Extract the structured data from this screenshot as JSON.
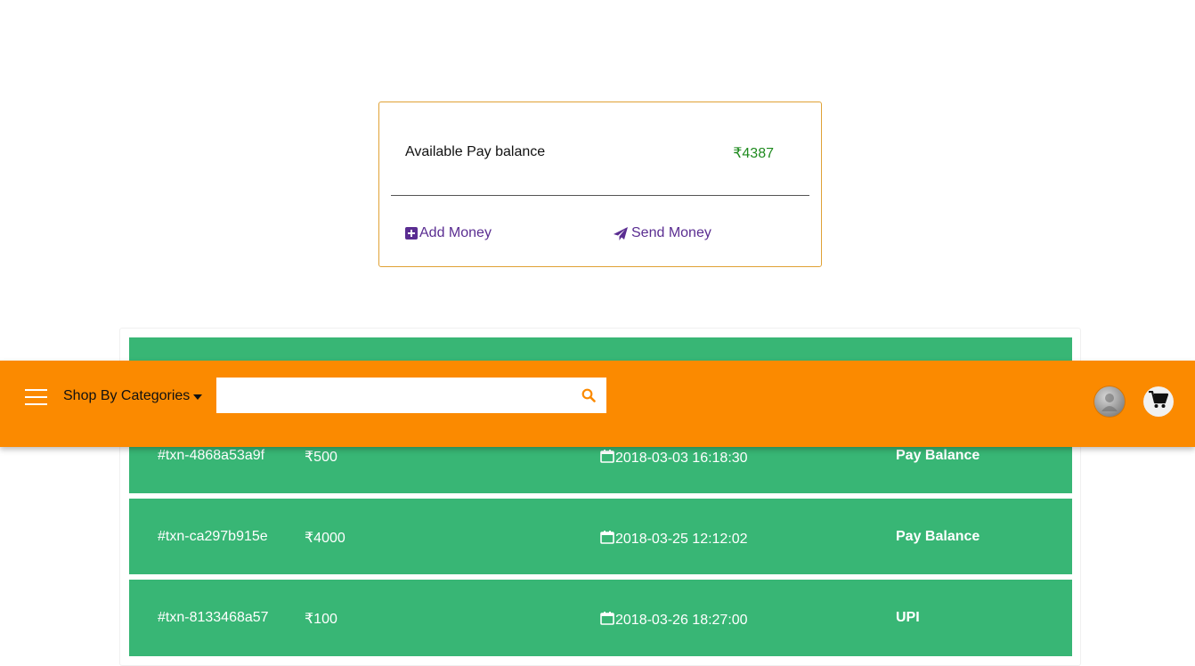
{
  "wallet": {
    "balance_label": "Available Pay balance",
    "balance_value": "₹4387",
    "add_money_label": "Add Money",
    "send_money_label": "Send Money"
  },
  "transactions": [
    {
      "id": "#txn-4868a53a9f",
      "amount": "₹500",
      "datetime": "2018-03-03 16:18:30",
      "method": "Pay Balance"
    },
    {
      "id": "#txn-ca297b915e",
      "amount": "₹4000",
      "datetime": "2018-03-25 12:12:02",
      "method": "Pay Balance"
    },
    {
      "id": "#txn-8133468a57",
      "amount": "₹100",
      "datetime": "2018-03-26 18:27:00",
      "method": "UPI"
    }
  ],
  "header": {
    "categories_label": "Shop By Categories",
    "search_placeholder": "",
    "search_value": ""
  },
  "colors": {
    "header_bg": "#fb8a00",
    "row_bg": "#38b675",
    "balance_value": "#1e8a1e",
    "action_link": "#5a2d91",
    "card_border": "#e0a236"
  },
  "icons": {
    "add": "plus-square-icon",
    "send": "paper-plane-icon",
    "date": "calendar-icon",
    "menu": "hamburger-icon",
    "search": "search-icon",
    "cart": "cart-icon"
  }
}
